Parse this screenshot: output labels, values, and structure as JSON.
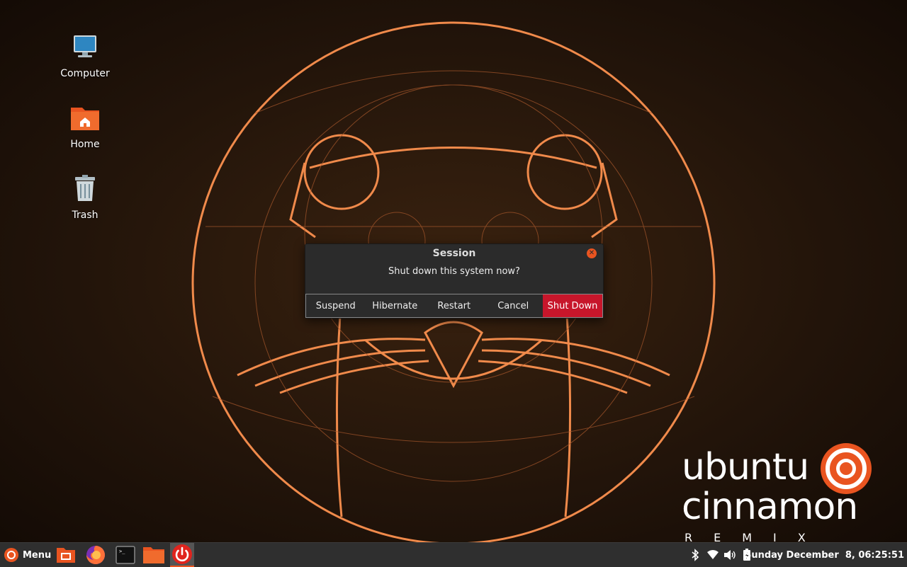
{
  "desktop": {
    "icons": [
      {
        "label": "Computer"
      },
      {
        "label": "Home"
      },
      {
        "label": "Trash"
      }
    ],
    "branding": {
      "line1": "ubuntu",
      "line2": "cinnamon",
      "line3": "REMIX"
    },
    "accent": "#e95420"
  },
  "dialog": {
    "title": "Session",
    "message": "Shut down this system now?",
    "buttons": {
      "suspend": "Suspend",
      "hibernate": "Hibernate",
      "restart": "Restart",
      "cancel": "Cancel",
      "shutdown": "Shut Down"
    },
    "shutdown_color": "#c7162b"
  },
  "panel": {
    "menu_label": "Menu",
    "launchers": [
      "desktop-icon",
      "firefox-icon",
      "terminal-icon",
      "folder-icon",
      "power-icon"
    ],
    "tray": [
      "bluetooth-icon",
      "wifi-icon",
      "volume-icon",
      "battery-icon"
    ],
    "clock": "Sunday December  8, 06:25:51"
  }
}
